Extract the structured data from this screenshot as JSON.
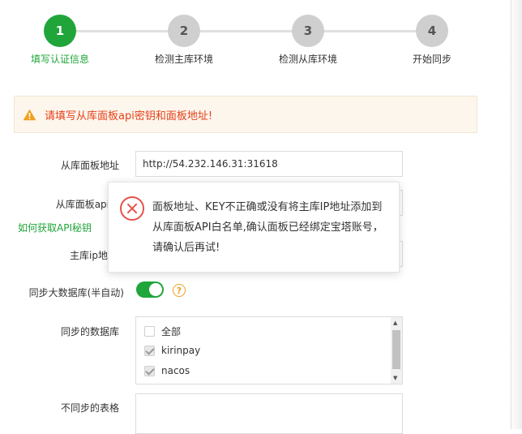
{
  "steps": [
    {
      "number": "1",
      "label": "填写认证信息",
      "active": true
    },
    {
      "number": "2",
      "label": "检测主库环境",
      "active": false
    },
    {
      "number": "3",
      "label": "检测从库环境",
      "active": false
    },
    {
      "number": "4",
      "label": "开始同步",
      "active": false
    }
  ],
  "alert": {
    "icon": "warning-icon",
    "text": "请填写从库面板api密钥和面板地址!"
  },
  "form": {
    "slave_panel_url_label": "从库面板地址",
    "slave_panel_url_value": "http://54.232.146.31:31618",
    "slave_api_key_label": "从库面板api密",
    "how_to_get_api_key": "如何获取API秘钥",
    "master_ip_label": "主库ip地",
    "sync_big_db_label": "同步大数据库(半自动)",
    "sync_big_db_enabled": true,
    "help_glyph": "?",
    "databases_label": "同步的数据库",
    "databases": [
      {
        "name": "全部",
        "checked": false
      },
      {
        "name": "kirinpay",
        "checked": true
      },
      {
        "name": "nacos",
        "checked": true
      }
    ],
    "excluded_tables_label": "不同步的表格"
  },
  "popup": {
    "icon": "error-circle-icon",
    "message": "面板地址、KEY不正确或没有将主库IP地址添加到从库面板API白名单,确认面板已经绑定宝塔账号，请确认后再试!"
  },
  "colors": {
    "accent": "#20a53a",
    "error": "#e5534b",
    "warning": "#f0a020"
  }
}
